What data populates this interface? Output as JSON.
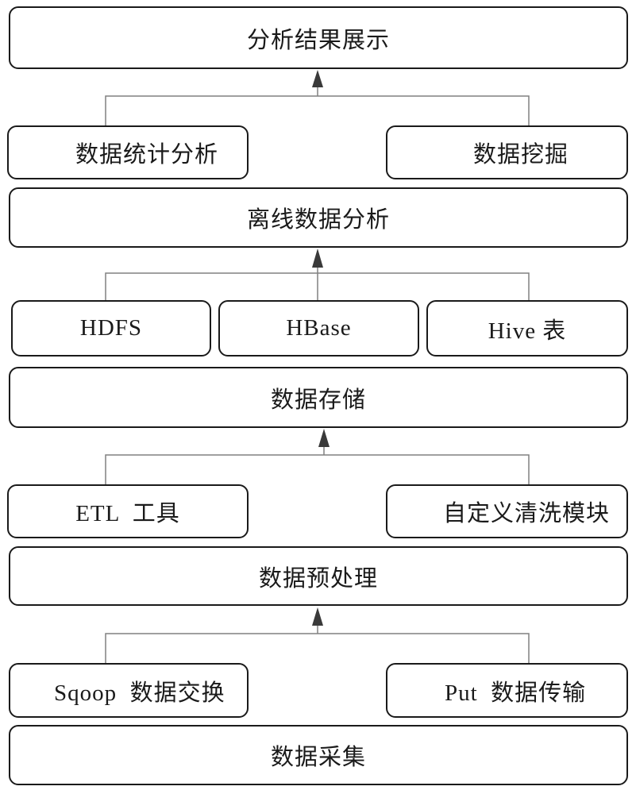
{
  "diagram": {
    "layers": [
      {
        "id": "result",
        "label": "分析结果展示"
      },
      {
        "id": "offline",
        "label": "离线数据分析"
      },
      {
        "id": "storage",
        "label": "数据存储"
      },
      {
        "id": "preprocess",
        "label": "数据预处理"
      },
      {
        "id": "collect",
        "label": "数据采集"
      }
    ],
    "components": {
      "stat": "数据统计分析",
      "mining": "数据挖掘",
      "hdfs": "HDFS",
      "hbase": "HBase",
      "hive": "Hive 表",
      "etl": "ETL  工具",
      "clean": "自定义清洗模块",
      "sqoop": "Sqoop  数据交换",
      "put": "Put  数据传输"
    },
    "colors": {
      "stroke": "#1a1a1a",
      "connector": "#808080",
      "arrow": "#3a3a3a"
    }
  }
}
